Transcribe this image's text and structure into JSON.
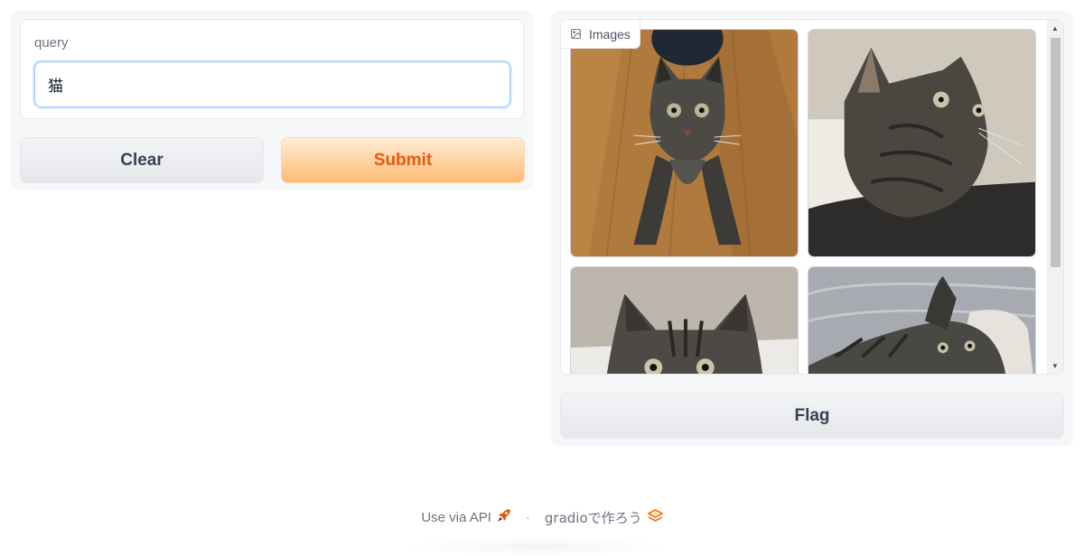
{
  "left": {
    "query_label": "query",
    "query_value": "猫",
    "clear_label": "Clear",
    "submit_label": "Submit"
  },
  "right": {
    "gallery_label": "Images",
    "gallery_icon": "image-icon",
    "flag_label": "Flag"
  },
  "footer": {
    "api_label": "Use via API",
    "separator": "·",
    "built_with": "gradioで作ろう",
    "api_icon": "rocket-icon",
    "gradio_icon": "gradio-logo-icon"
  },
  "colors": {
    "submit_text": "#ea580c",
    "submit_bg": "#fdba74",
    "input_focus": "#93c5fd"
  }
}
